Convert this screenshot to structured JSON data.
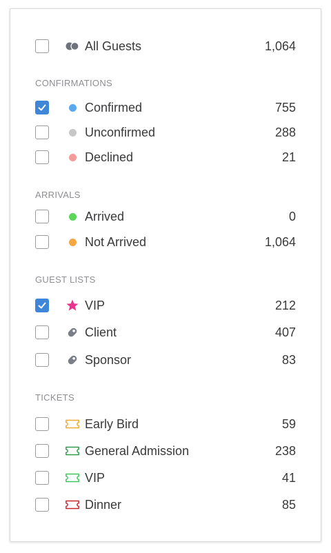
{
  "all": {
    "label": "All Guests",
    "count": "1,064",
    "checked": false
  },
  "sections": {
    "confirmations": "CONFIRMATIONS",
    "arrivals": "ARRIVALS",
    "guest_lists": "GUEST LISTS",
    "tickets": "TICKETS"
  },
  "confirmations": [
    {
      "label": "Confirmed",
      "count": "755",
      "checked": true,
      "color": "#5aa9f0",
      "icon": "dot"
    },
    {
      "label": "Unconfirmed",
      "count": "288",
      "checked": false,
      "color": "#c7c7c7",
      "icon": "dot"
    },
    {
      "label": "Declined",
      "count": "21",
      "checked": false,
      "color": "#f39c9a",
      "icon": "dot"
    }
  ],
  "arrivals": [
    {
      "label": "Arrived",
      "count": "0",
      "checked": false,
      "color": "#5ad65a",
      "icon": "dot"
    },
    {
      "label": "Not Arrived",
      "count": "1,064",
      "checked": false,
      "color": "#f5a742",
      "icon": "dot"
    }
  ],
  "guest_lists": [
    {
      "label": "VIP",
      "count": "212",
      "checked": true,
      "color": "#e8348f",
      "icon": "star-icon"
    },
    {
      "label": "Client",
      "count": "407",
      "checked": false,
      "color": "#7a7f87",
      "icon": "tag-icon"
    },
    {
      "label": "Sponsor",
      "count": "83",
      "checked": false,
      "color": "#7a7f87",
      "icon": "tag-icon"
    }
  ],
  "tickets": [
    {
      "label": "Early Bird",
      "count": "59",
      "checked": false,
      "color": "#f0a830",
      "icon": "ticket-icon"
    },
    {
      "label": "General Admission",
      "count": "238",
      "checked": false,
      "color": "#2e9a4a",
      "icon": "ticket-icon"
    },
    {
      "label": "VIP",
      "count": "41",
      "checked": false,
      "color": "#3cc75a",
      "icon": "ticket-icon"
    },
    {
      "label": "Dinner",
      "count": "85",
      "checked": false,
      "color": "#c8262e",
      "icon": "ticket-icon"
    }
  ],
  "colors": {
    "checkbox_checked": "#3f86d9",
    "all_guests_icon": "#6e737b"
  }
}
